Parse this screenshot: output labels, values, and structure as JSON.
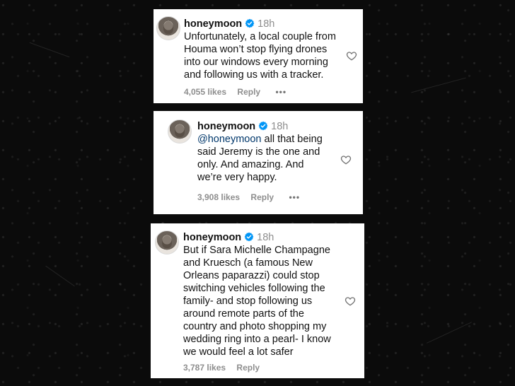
{
  "colors": {
    "background": "#0b0b0b",
    "card": "#ffffff",
    "verified_blue": "#0095f6",
    "mention": "#00376b",
    "muted": "#8e8e8e"
  },
  "comments": [
    {
      "username": "honeymoon",
      "time": "18h",
      "mention": "",
      "lines": [
        "Unfortunately, a local couple from",
        "Houma won’t stop flying drones",
        "into our windows every morning",
        "and following us with a tracker."
      ],
      "likes": "4,055 likes",
      "reply_label": "Reply",
      "more_label": "•••",
      "icons": [
        "avatar",
        "verified-icon",
        "heart-icon",
        "more-icon"
      ]
    },
    {
      "username": "honeymoon",
      "time": "18h",
      "mention": "@honeymoon",
      "first_line_rest": " all that being",
      "lines": [
        "said Jeremy is the one and",
        "only. And amazing. And",
        "we’re very happy."
      ],
      "likes": "3,908 likes",
      "reply_label": "Reply",
      "more_label": "•••",
      "icons": [
        "avatar",
        "verified-icon",
        "heart-icon",
        "more-icon"
      ]
    },
    {
      "username": "honeymoon",
      "time": "18h",
      "mention": "",
      "lines": [
        "But if Sara Michelle Champagne",
        "and Kruesch (a famous New",
        "Orleans paparazzi) could stop",
        "switching vehicles following the",
        "family- and stop following us",
        "around remote parts of the",
        "country and photo shopping my",
        "wedding ring into a pearl- I know",
        "we would feel a lot safer"
      ],
      "likes": "3,787 likes",
      "reply_label": "Reply",
      "icons": [
        "avatar",
        "verified-icon",
        "heart-icon"
      ]
    }
  ]
}
